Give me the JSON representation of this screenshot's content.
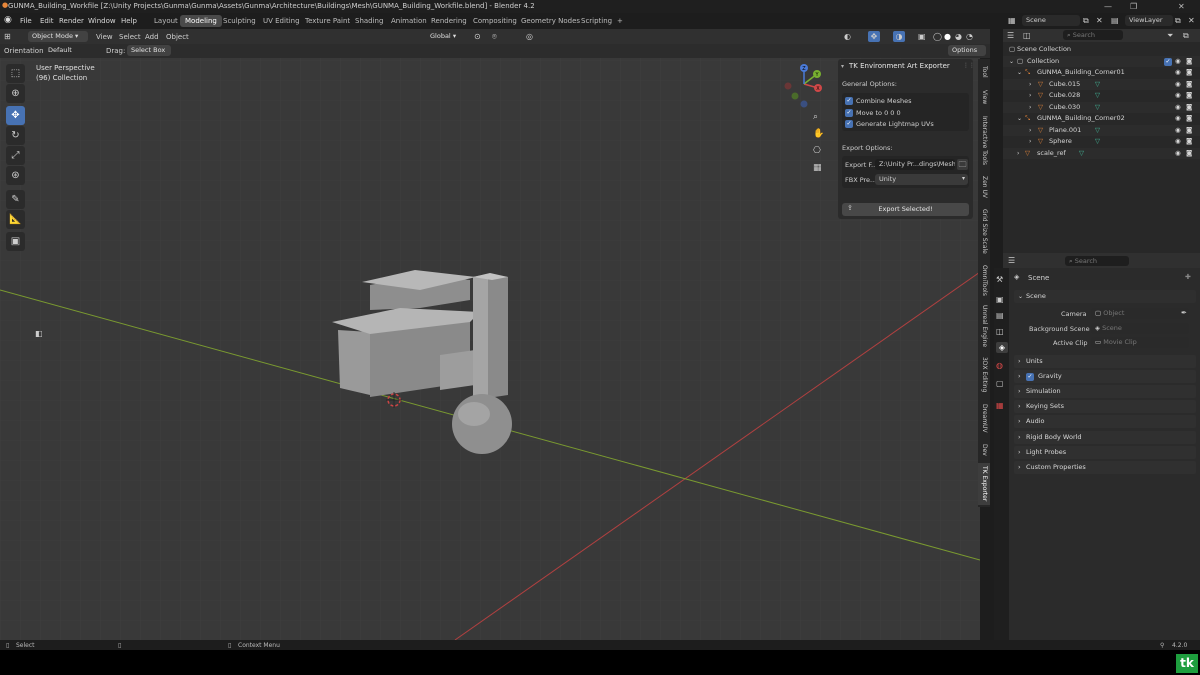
{
  "titlebar": {
    "title": "GUNMA_Building_Workfile [Z:\\Unity Projects\\Gunma\\Gunma\\Assets\\Gunma\\Architecture\\Buildings\\Mesh\\GUNMA_Building_Workfile.blend] - Blender 4.2",
    "minimize": "—",
    "maximize": "❐",
    "close": "✕"
  },
  "menus": [
    "File",
    "Edit",
    "Render",
    "Window",
    "Help"
  ],
  "workspaces": [
    "Layout",
    "Modeling",
    "Sculpting",
    "UV Editing",
    "Texture Paint",
    "Shading",
    "Animation",
    "Rendering",
    "Compositing",
    "Geometry Nodes",
    "Scripting",
    "+"
  ],
  "active_workspace": "Modeling",
  "scene_selector": {
    "scene": "Scene",
    "view_layer": "ViewLayer"
  },
  "viewport_header": {
    "mode": "Object Mode",
    "view": "View",
    "select": "Select",
    "add": "Add",
    "object": "Object",
    "transform_orientation": "Global",
    "options": "Options"
  },
  "tool_settings": {
    "orientation_label": "Orientation:",
    "orientation_value": "Default",
    "drag_label": "Drag:",
    "drag_value": "Select Box"
  },
  "viewport_overlay": {
    "perspective": "User Perspective",
    "collection": "(96) Collection"
  },
  "gizmo": {
    "x": "X",
    "y": "Y",
    "z": "Z"
  },
  "npanel": {
    "title": "TK Environment Art Exporter",
    "general_label": "General Options:",
    "options": [
      {
        "label": "Combine Meshes",
        "checked": true
      },
      {
        "label": "Move to 0 0 0",
        "checked": true
      },
      {
        "label": "Generate Lightmap UVs",
        "checked": true
      }
    ],
    "export_label": "Export Options:",
    "export_folder_label": "Export F...",
    "export_folder_value": "Z:\\Unity Pr...dings\\Mesh\\",
    "fbx_preset_label": "FBX Pre...",
    "fbx_preset_value": "Unity",
    "export_button": "Export Selected!"
  },
  "side_tabs": [
    "Tool",
    "View",
    "Interactive Tools",
    "Zen UV",
    "Grid Size Scale",
    "OmniTools",
    "Unreal Engine",
    "3DX Editing",
    "DreamUV",
    "Dev",
    "TK Exporter"
  ],
  "active_side_tab": "TK Exporter",
  "outliner": {
    "search_placeholder": "Search",
    "rows": [
      {
        "label": "Scene Collection",
        "depth": 0,
        "icon": "collection-icon"
      },
      {
        "label": "Collection",
        "depth": 1,
        "icon": "collection-icon"
      },
      {
        "label": "GUNMA_Building_Corner01",
        "depth": 2,
        "icon": "object-icon"
      },
      {
        "label": "Cube.015",
        "depth": 3,
        "icon": "mesh-icon"
      },
      {
        "label": "Cube.028",
        "depth": 3,
        "icon": "mesh-icon"
      },
      {
        "label": "Cube.030",
        "depth": 3,
        "icon": "mesh-icon"
      },
      {
        "label": "GUNMA_Building_Corner02",
        "depth": 2,
        "icon": "object-icon"
      },
      {
        "label": "Plane.001",
        "depth": 3,
        "icon": "mesh-icon"
      },
      {
        "label": "Sphere",
        "depth": 3,
        "icon": "mesh-icon"
      },
      {
        "label": "scale_ref",
        "depth": 2,
        "icon": "mesh-icon"
      }
    ]
  },
  "properties": {
    "search_placeholder": "Search",
    "scene_name": "Scene",
    "section_scene": "Scene",
    "camera_label": "Camera",
    "camera_placeholder": "Object",
    "bg_scene_label": "Background Scene",
    "bg_scene_placeholder": "Scene",
    "active_clip_label": "Active Clip",
    "active_clip_placeholder": "Movie Clip",
    "sections": [
      "Units",
      "Gravity",
      "Simulation",
      "Keying Sets",
      "Audio",
      "Rigid Body World",
      "Light Probes",
      "Custom Properties"
    ],
    "gravity_checked": true
  },
  "statusbar": {
    "select": "Select",
    "context_menu": "Context Menu",
    "version": "4.2.0"
  },
  "logo_text": "tk"
}
